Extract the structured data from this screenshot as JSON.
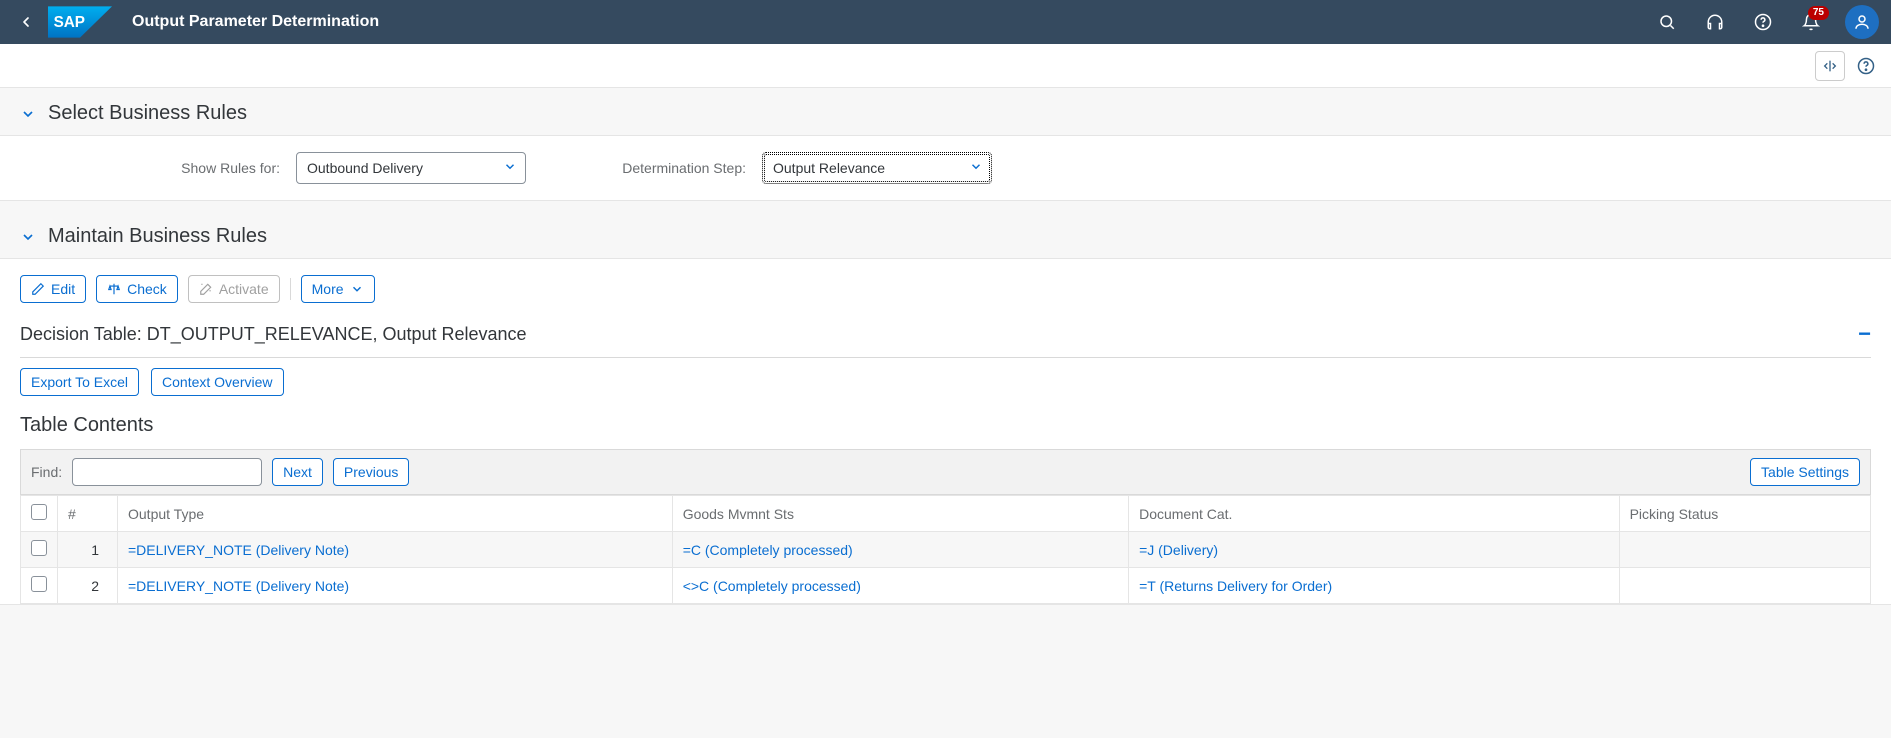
{
  "header": {
    "title": "Output Parameter Determination",
    "notification_count": "75"
  },
  "panels": {
    "select": {
      "title": "Select Business Rules"
    },
    "maintain": {
      "title": "Maintain Business Rules"
    }
  },
  "form": {
    "show_rules_label": "Show Rules for:",
    "show_rules_value": "Outbound Delivery",
    "step_label": "Determination Step:",
    "step_value": "Output Relevance"
  },
  "toolbar": {
    "edit": "Edit",
    "check": "Check",
    "activate": "Activate",
    "more": "More"
  },
  "decision": {
    "title": "Decision Table: DT_OUTPUT_RELEVANCE, Output Relevance",
    "export": "Export To Excel",
    "context": "Context Overview"
  },
  "table": {
    "section_title": "Table Contents",
    "find_label": "Find:",
    "next": "Next",
    "previous": "Previous",
    "settings": "Table Settings",
    "cols": {
      "num": "#",
      "output_type": "Output Type",
      "goods": "Goods Mvmnt Sts",
      "doccat": "Document Cat.",
      "picking": "Picking Status"
    },
    "rows": [
      {
        "num": "1",
        "output_type": "=DELIVERY_NOTE (Delivery Note)",
        "goods": "=C (Completely processed)",
        "doccat": "=J (Delivery)",
        "picking": ""
      },
      {
        "num": "2",
        "output_type": "=DELIVERY_NOTE (Delivery Note)",
        "goods": "<>C (Completely processed)",
        "doccat": "=T (Returns Delivery for Order)",
        "picking": ""
      }
    ]
  }
}
